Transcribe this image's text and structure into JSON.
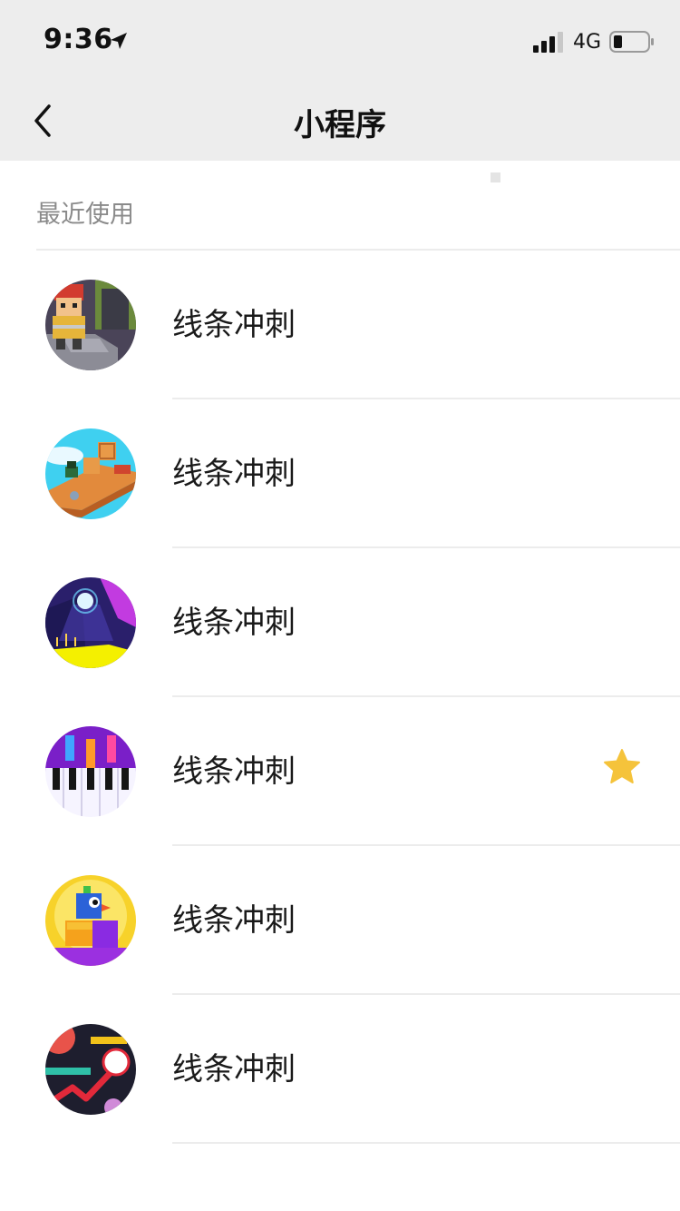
{
  "status_bar": {
    "time": "9:36",
    "network": "4G",
    "icons": [
      "location-arrow-icon",
      "signal-icon",
      "battery-icon"
    ]
  },
  "nav": {
    "back_icon": "chevron-left-icon",
    "title": "小程序"
  },
  "section": {
    "title": "最近使用"
  },
  "items": [
    {
      "label": "线条冲刺",
      "icon": "fireman-voxel-game-icon",
      "starred": false
    },
    {
      "label": "线条冲刺",
      "icon": "crate-bridge-game-icon",
      "starred": false
    },
    {
      "label": "线条冲刺",
      "icon": "bouncing-ball-game-icon",
      "starred": false
    },
    {
      "label": "线条冲刺",
      "icon": "piano-tiles-game-icon",
      "starred": true
    },
    {
      "label": "线条冲刺",
      "icon": "blue-bird-game-icon",
      "starred": false
    },
    {
      "label": "线条冲刺",
      "icon": "line-dash-game-icon",
      "starred": false
    }
  ],
  "colors": {
    "header_bg": "#ededed",
    "star": "#f5c33b",
    "divider": "#ececec",
    "section_text": "#8a8a8a"
  }
}
